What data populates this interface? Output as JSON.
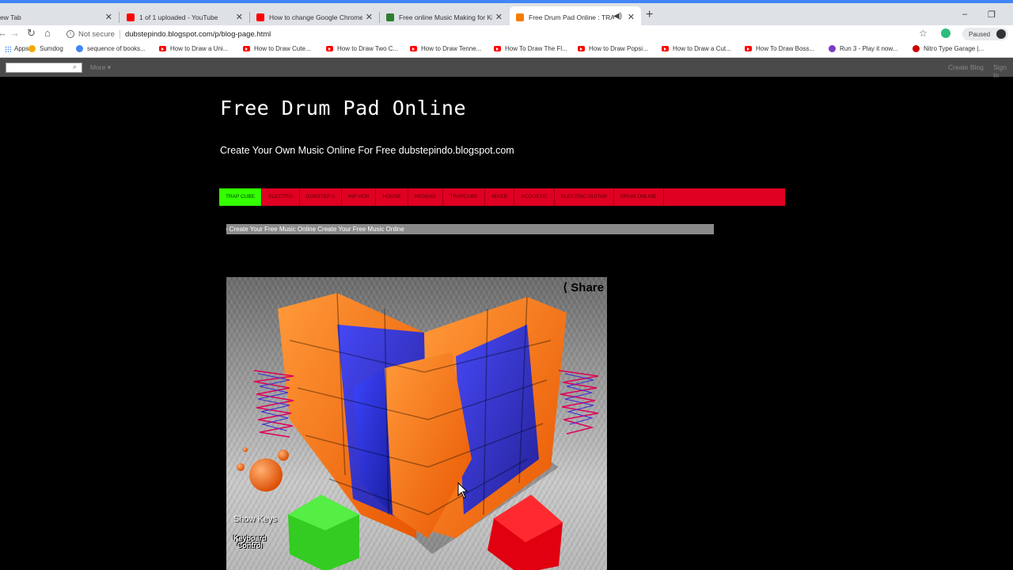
{
  "browser": {
    "tabs": [
      {
        "title": "ew Tab",
        "icon": "none",
        "color": "#dee1e6"
      },
      {
        "title": "1 of 1 uploaded - YouTube",
        "icon": "youtube-icon",
        "color": "#ff0000"
      },
      {
        "title": "How to change Google Chrome",
        "icon": "youtube-icon",
        "color": "#ff0000"
      },
      {
        "title": "Free online Music Making for Kid",
        "icon": "site-icon",
        "color": "#2e7d32"
      },
      {
        "title": "Free Drum Pad Online : TRA",
        "icon": "blogger-icon",
        "color": "#f57c00"
      }
    ],
    "new_tab_symbol": "+",
    "window_controls": {
      "minimize": "–",
      "restore": "❐"
    },
    "nav": {
      "back": "←",
      "forward": "→",
      "reload": "↻",
      "home": "⌂"
    },
    "omnibox": {
      "security_label": "Not secure",
      "url": "dubstepindo.blogspot.com/p/blog-page.html"
    },
    "profile_status": "Paused",
    "bookmarks": [
      {
        "label": "Apps",
        "icon": "apps-icon"
      },
      {
        "label": "Sumdog",
        "icon": "sumdog-icon"
      },
      {
        "label": "sequence of books...",
        "icon": "google-icon"
      },
      {
        "label": "How to Draw a Uni...",
        "icon": "youtube-icon"
      },
      {
        "label": "How to Draw Cute...",
        "icon": "youtube-icon"
      },
      {
        "label": "How to Draw Two C...",
        "icon": "youtube-icon"
      },
      {
        "label": "How to Draw Tenne...",
        "icon": "youtube-icon"
      },
      {
        "label": "How To Draw The Fl...",
        "icon": "youtube-icon"
      },
      {
        "label": "How to Draw Popsi...",
        "icon": "youtube-icon"
      },
      {
        "label": "How to Draw a Cut...",
        "icon": "youtube-icon"
      },
      {
        "label": "How To Draw Boss...",
        "icon": "youtube-icon"
      },
      {
        "label": "Run 3 - Play it now...",
        "icon": "run3-icon"
      },
      {
        "label": "Nitro Type Garage |...",
        "icon": "nitro-icon"
      }
    ]
  },
  "blogger_bar": {
    "more": "More ▾",
    "create_blog": "Create Blog",
    "sign_in": "Sign In"
  },
  "page": {
    "title": "Free Drum Pad Online",
    "description": "Create Your Own Music Online For Free dubstepindo.blogspot.com",
    "menu": [
      "TRAP CUBE",
      "ELECTRO",
      "DUBSTEP 2",
      "HIP HOP",
      "HOUSE",
      "REGGAE",
      "TRAPCUBE",
      "MIXER",
      "ACOUSTIC",
      "ELECTRIC GUITAR",
      "DRUM ONLINE"
    ],
    "marquee": "e Create Your Free Music Online Create Your Free Music Online"
  },
  "game": {
    "share": "⟨ Share",
    "show_keys": "Show Keys",
    "keyboard_control": "Keyboard\nControl",
    "colors": {
      "orange": "#ff6a00",
      "blue": "#2a2fc8",
      "green": "#33cc22",
      "red": "#e00010"
    }
  }
}
